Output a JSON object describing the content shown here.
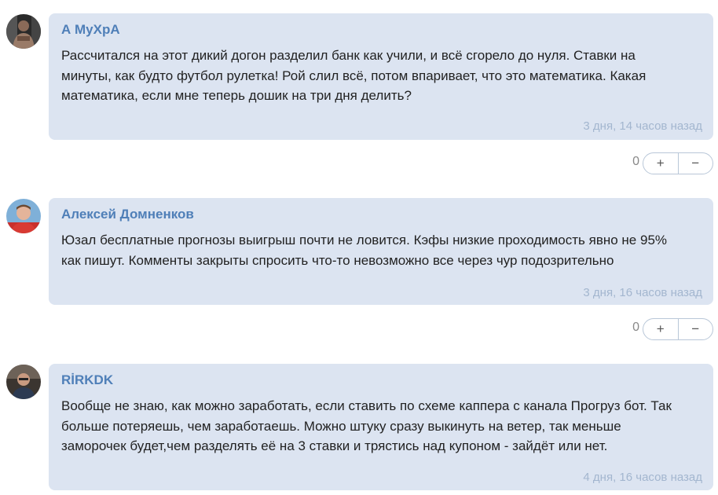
{
  "comments": [
    {
      "author": "А МуХрА",
      "text": "Рассчитался на этот дикий догон разделил банк как учили, и всё сгорело до нуля. Ставки на\nминуты, как будто футбол рулетка! Рой слил всё, потом впаривает, что это математика. Какая\nматематика, если мне теперь дошик на три дня делить?",
      "time": "3 дня, 14 часов назад",
      "votes": "0",
      "plus": "+",
      "minus": "−"
    },
    {
      "author": "Алексей Домненков",
      "text": "Юзал бесплатные прогнозы выигрыш почти не ловится. Кэфы низкие проходимость явно не 95%\nкак пишут. Комменты закрыты спросить что-то невозможно все через чур подозрительно",
      "time": "3 дня, 16 часов назад",
      "votes": "0",
      "plus": "+",
      "minus": "−"
    },
    {
      "author": "RİRKDK",
      "text": "Вообще не знаю, как можно заработать, если ставить по схеме каппера с канала Прогруз бот. Так\nбольше потеряешь, чем заработаешь. Можно штуку сразу выкинуть на ветер, так меньше\nзаморочек будет,чем разделять её на 3 ставки и трястись над купоном - зайдёт или нет.",
      "time": "4 дня, 16 часов назад"
    }
  ],
  "colors": {
    "bubble": "#dce4f1",
    "author": "#4f7fb8",
    "timestamp": "#a3b6cf",
    "text": "#222222"
  }
}
